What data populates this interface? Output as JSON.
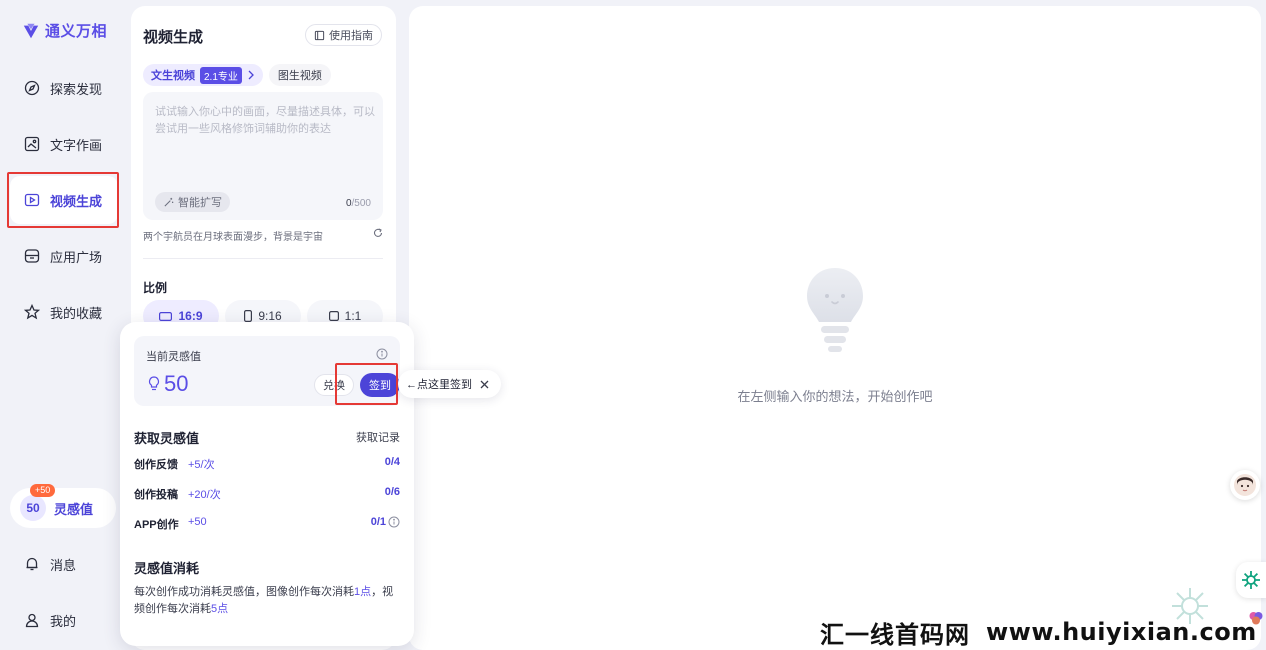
{
  "app": {
    "name": "通义万相",
    "brand_color": "#5b4ee6"
  },
  "nav": {
    "items": [
      {
        "label": "探索发现",
        "icon": "compass-icon"
      },
      {
        "label": "文字作画",
        "icon": "image-icon"
      },
      {
        "label": "视频生成",
        "icon": "video-icon",
        "active": true
      },
      {
        "label": "应用广场",
        "icon": "store-icon"
      },
      {
        "label": "我的收藏",
        "icon": "star-icon"
      }
    ],
    "credits": {
      "value": "50",
      "label": "灵感值",
      "badge": "+50"
    },
    "bottom": [
      {
        "label": "消息",
        "icon": "bell-icon"
      },
      {
        "label": "我的",
        "icon": "user-icon"
      }
    ]
  },
  "panel": {
    "title": "视频生成",
    "guide_label": "使用指南",
    "tab_main": "文生视频",
    "tab_badge": "2.1专业",
    "tab_sub": "图生视频",
    "prompt_placeholder": "试试输入你心中的画面，尽量描述具体，可以尝试用一些风格修饰词辅助你的表达",
    "expand_label": "智能扩写",
    "char_current": "0",
    "char_max": "/500",
    "example_hint": "两个宇航员在月球表面漫步，背景是宇宙",
    "ratio_title": "比例",
    "ratios": [
      "16:9",
      "9:16",
      "1:1"
    ]
  },
  "popover": {
    "current_label": "当前灵感值",
    "current_value": "50",
    "exchange_label": "兑换",
    "signin_label": "签到",
    "earn_title": "获取灵感值",
    "record_label": "获取记录",
    "rows": [
      {
        "name": "创作反馈",
        "reward": "+5/次",
        "progress": "0/4"
      },
      {
        "name": "创作投稿",
        "reward": "+20/次",
        "progress": "0/6"
      },
      {
        "name": "APP创作",
        "reward": "+50",
        "progress": "0/1"
      }
    ],
    "consume_title": "灵感值消耗",
    "consume_desc_1": "每次创作成功消耗灵感值，图像创作每次消耗",
    "consume_hl_1": "1点",
    "consume_desc_2": "，视频创作每次消耗",
    "consume_hl_2": "5点"
  },
  "tooltip": {
    "text": "←点这里签到"
  },
  "main": {
    "empty_text": "在左侧输入你的想法，开始创作吧"
  },
  "watermark": {
    "cn": "汇一线首码网",
    "url": "www.huiyixian.com"
  }
}
